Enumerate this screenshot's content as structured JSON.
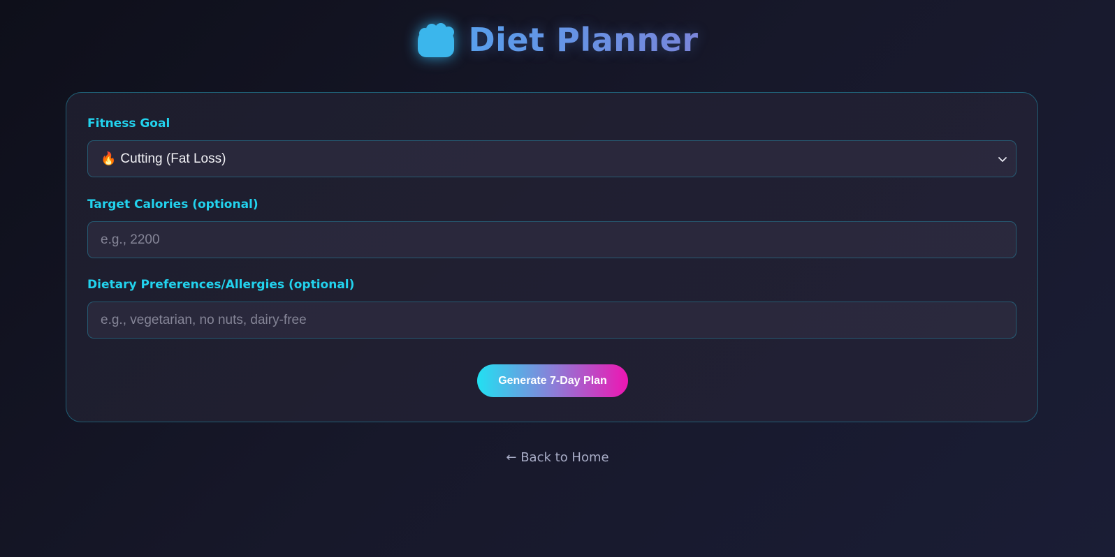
{
  "header": {
    "title": "Diet Planner",
    "icon": "food-icon",
    "icon_color": "#3bb6ec"
  },
  "form": {
    "fitness_goal": {
      "label": "Fitness Goal",
      "selected_icon": "🔥",
      "selected_value": "Cutting (Fat Loss)"
    },
    "target_calories": {
      "label": "Target Calories (optional)",
      "placeholder": "e.g., 2200",
      "value": ""
    },
    "dietary_preferences": {
      "label": "Dietary Preferences/Allergies (optional)",
      "placeholder": "e.g., vegetarian, no nuts, dairy-free",
      "value": ""
    },
    "submit_label": "Generate 7-Day Plan"
  },
  "footer": {
    "back_link": "← Back to Home"
  },
  "colors": {
    "accent": "#22d3ee",
    "button_gradient_start": "#22e0f2",
    "button_gradient_end": "#ee16b2",
    "background": "#13142a"
  }
}
